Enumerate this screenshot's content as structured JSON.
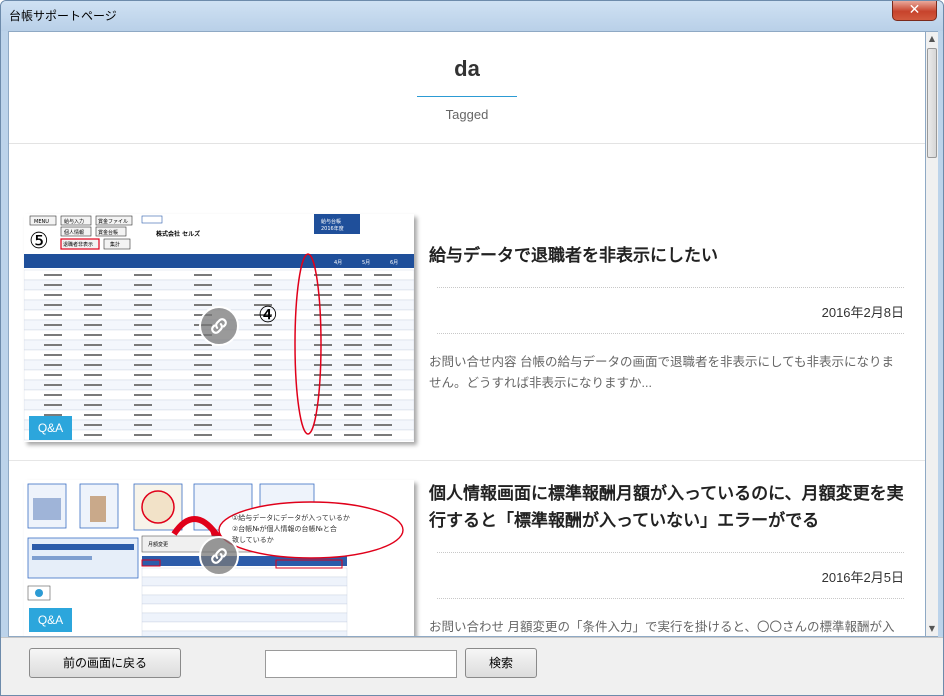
{
  "window": {
    "title": "台帳サポートページ",
    "close_label": "✕"
  },
  "header": {
    "title": "da",
    "subtitle": "Tagged"
  },
  "articles": [
    {
      "title": "給与データで退職者を非表示にしたい",
      "date": "2016年2月8日",
      "excerpt": "お問い合せ内容 台帳の給与データの画面で退職者を非表示にしても非表示になりません。どうすれば非表示になりますか...",
      "tag": "Q&A",
      "thumb": {
        "buttons": [
          "MENU",
          "給与入力",
          "賞金ファイル",
          "個人情報",
          "賞金台帳",
          "退職者非表示",
          "集計"
        ],
        "company": "株式会社 セルズ",
        "year_label": "給与台帳",
        "year_sub": "2016年度",
        "num_a": "⑤",
        "num_b": "④",
        "months": [
          "4月",
          "5月",
          "6月"
        ]
      }
    },
    {
      "title": "個人情報画面に標準報酬月額が入っているのに、月額変更を実行すると「標準報酬が入っていない」エラーがでる",
      "date": "2016年2月5日",
      "excerpt": "お問い合わせ 月額変更の「条件入力」で実行を掛けると、〇〇さんの標準報酬が入って",
      "tag": "Q&A",
      "thumb": {
        "bubble_line1": "①給与データにデータが入っているか",
        "bubble_line2": "②台帳№が個人情報の台帳№と合",
        "bubble_line3": "致しているか",
        "small_label": "月額変更"
      }
    }
  ],
  "footer": {
    "back_label": "前の画面に戻る",
    "search_value": "",
    "search_label": "検索"
  }
}
